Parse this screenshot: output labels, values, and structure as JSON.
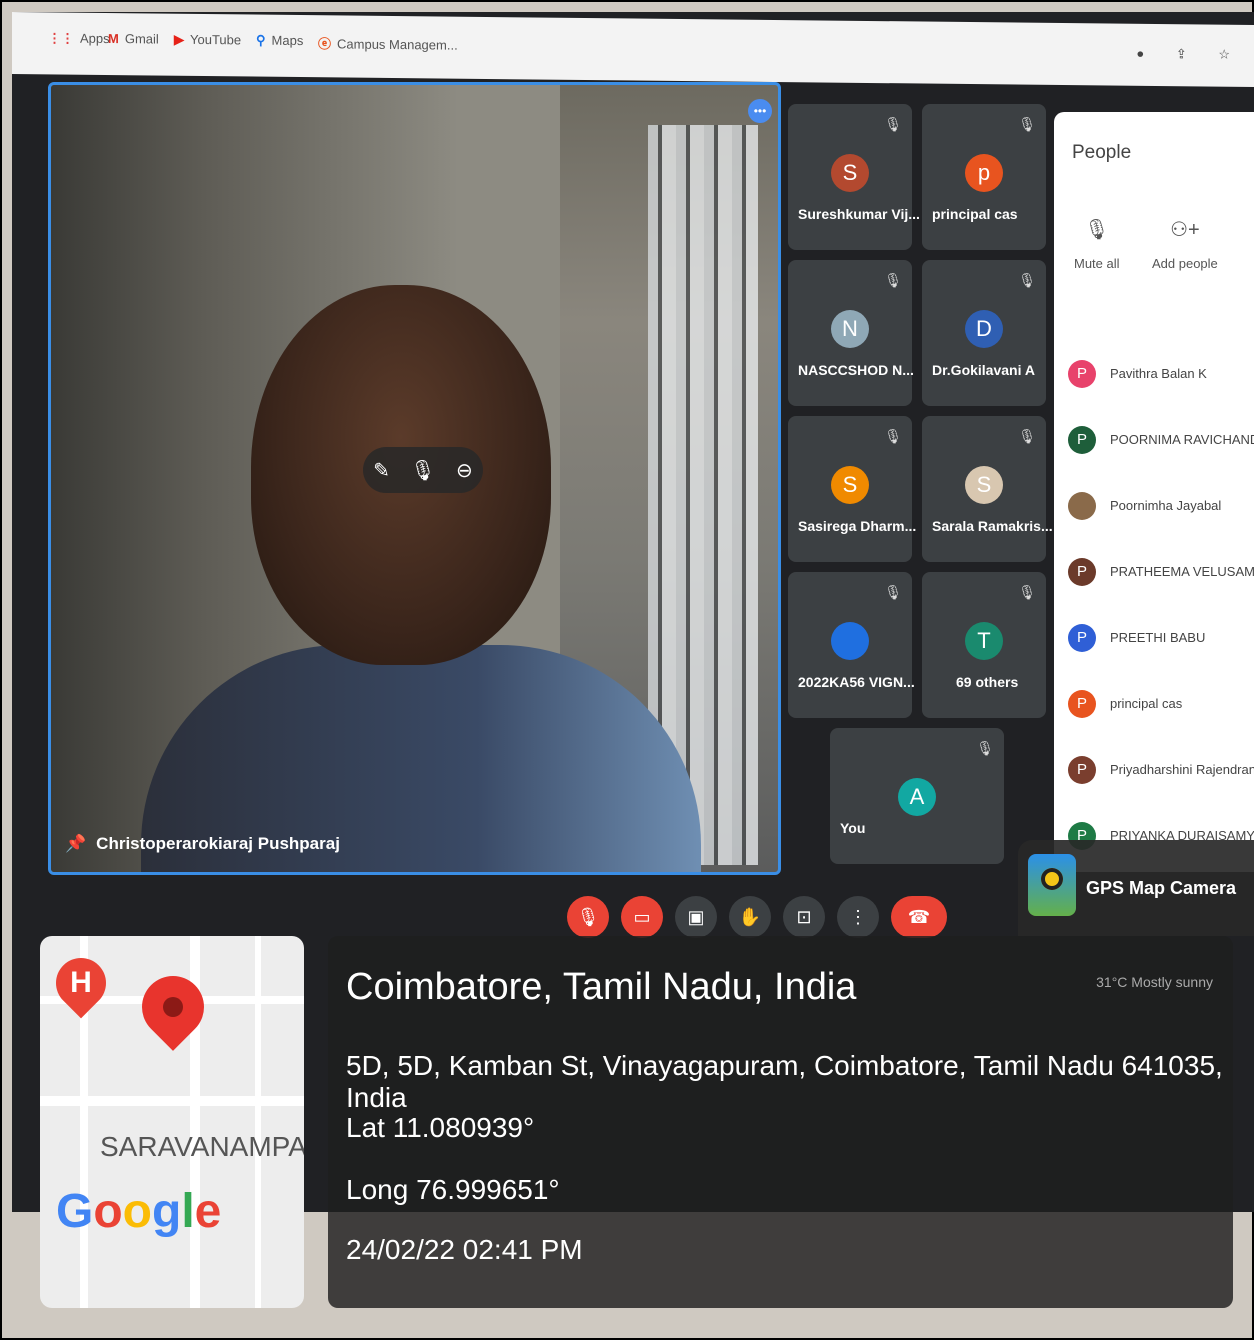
{
  "bookmarks": [
    {
      "icon": "apps-icon",
      "glyph": "⋮⋮",
      "label": "Apps"
    },
    {
      "icon": "gmail-icon",
      "glyph": "M",
      "label": "Gmail"
    },
    {
      "icon": "youtube-icon",
      "glyph": "▶",
      "label": "YouTube"
    },
    {
      "icon": "maps-icon",
      "glyph": "⚲",
      "label": "Maps"
    },
    {
      "icon": "campus-icon",
      "glyph": "ⓔ",
      "label": "Campus Managem..."
    }
  ],
  "main_speaker": {
    "name": "Christoperarokiaraj Pushparaj"
  },
  "tiles": [
    {
      "name": "Sureshkumar Vij...",
      "initial": "S",
      "color": "#b3492f"
    },
    {
      "name": "principal cas",
      "initial": "p",
      "color": "#e8541f"
    },
    {
      "name": "NASCCSHOD N...",
      "initial": "N",
      "color": "#8fa8b6"
    },
    {
      "name": "Dr.Gokilavani A",
      "initial": "D",
      "color": "#2f5fb3"
    },
    {
      "name": "Sasirega Dharm...",
      "initial": "S",
      "color": "#f08a00"
    },
    {
      "name": "Sarala Ramakris...",
      "initial": "S",
      "color": "#d8c7b0"
    },
    {
      "name": "2022KA56 VIGN...",
      "initial": "",
      "color": "#1f6fe0"
    },
    {
      "name": "69 others",
      "initial": "T",
      "color": "#1a8a6e"
    },
    {
      "name": "You",
      "initial": "A",
      "color": "#12a8a2"
    }
  ],
  "people_panel": {
    "title": "People",
    "mute_all": "Mute all",
    "add_people": "Add people",
    "list": [
      {
        "initial": "P",
        "name": "Pavithra Balan K",
        "color": "#e8426b"
      },
      {
        "initial": "P",
        "name": "POORNIMA RAVICHAND...",
        "color": "#1e5e3a"
      },
      {
        "initial": "",
        "name": "Poornimha Jayabal",
        "color": "#8a6a4a"
      },
      {
        "initial": "P",
        "name": "PRATHEEMA VELUSAMY",
        "color": "#6b3a2a"
      },
      {
        "initial": "P",
        "name": "PREETHI BABU",
        "color": "#2f5fd6"
      },
      {
        "initial": "P",
        "name": "principal cas",
        "color": "#e8541f"
      },
      {
        "initial": "P",
        "name": "Priyadharshini Rajendran",
        "color": "#7a3e2e"
      },
      {
        "initial": "P",
        "name": "PRIYANKA DURAISAMY",
        "color": "#1e7a45"
      }
    ]
  },
  "gps_app": {
    "label": "GPS Map Camera"
  },
  "map": {
    "area": "SARAVANAMPATTI",
    "h_marker": "H"
  },
  "location": {
    "city": "Coimbatore, Tamil Nadu, India",
    "address": "5D, 5D, Kamban St, Vinayagapuram, Coimbatore, Tamil Nadu 641035, India",
    "lat": "Lat 11.080939°",
    "long": "Long 76.999651°",
    "datetime": "24/02/22 02:41 PM",
    "weather": "31°C Mostly sunny"
  }
}
